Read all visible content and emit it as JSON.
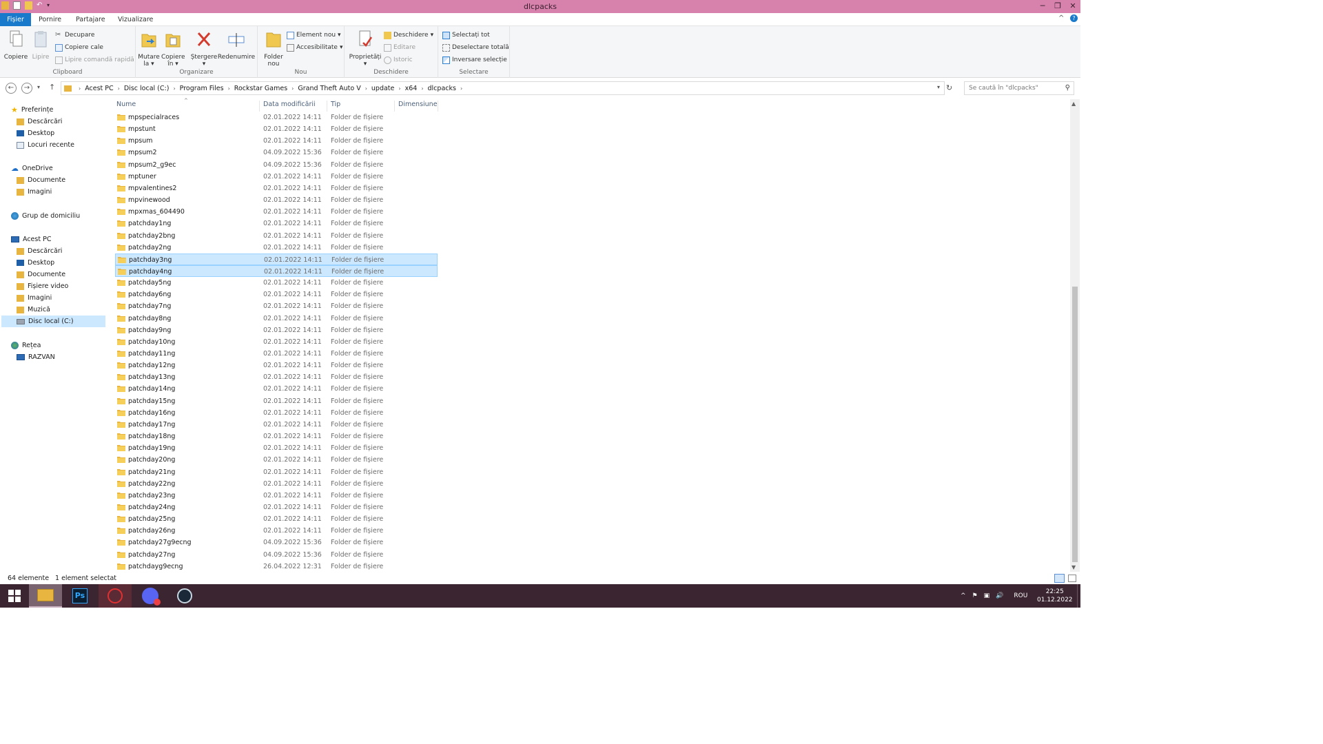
{
  "window": {
    "title": "dlcpacks",
    "minimize": "─",
    "maximize": "❐",
    "close": "✕"
  },
  "tabs": {
    "file": "Fișier",
    "home": "Pornire",
    "share": "Partajare",
    "view": "Vizualizare",
    "collapse": "^",
    "help": "?"
  },
  "ribbon": {
    "clipboard": {
      "label": "Clipboard",
      "copy": "Copiere",
      "paste": "Lipire",
      "cut": "Decupare",
      "copy_path": "Copiere cale",
      "paste_shortcut": "Lipire comandă rapidă"
    },
    "organize": {
      "label": "Organizare",
      "move_to": "Mutare",
      "move_to_2": "la",
      "copy_to": "Copiere",
      "copy_to_2": "în",
      "delete": "Ștergere",
      "rename": "Redenumire"
    },
    "new": {
      "label": "Nou",
      "new_folder": "Folder",
      "new_folder_2": "nou",
      "new_item": "Element nou",
      "easy_access": "Accesibilitate"
    },
    "open": {
      "label": "Deschidere",
      "properties": "Proprietăți",
      "open": "Deschidere",
      "edit": "Editare",
      "history": "Istoric"
    },
    "select": {
      "label": "Selectare",
      "select_all": "Selectați tot",
      "select_none": "Deselectare totală",
      "invert": "Inversare selecție"
    }
  },
  "address": {
    "crumbs": [
      "Acest PC",
      "Disc local (C:)",
      "Program Files",
      "Rockstar Games",
      "Grand Theft Auto V",
      "update",
      "x64",
      "dlcpacks"
    ],
    "search_placeholder": "Se caută în \"dlcpacks\""
  },
  "nav": {
    "favorites": "Preferințe",
    "fav_downloads": "Descărcări",
    "fav_desktop": "Desktop",
    "fav_recent": "Locuri recente",
    "onedrive": "OneDrive",
    "od_documents": "Documente",
    "od_images": "Imagini",
    "homegroup": "Grup de domiciliu",
    "thispc": "Acest PC",
    "pc_downloads": "Descărcări",
    "pc_desktop": "Desktop",
    "pc_documents": "Documente",
    "pc_videos": "Fișiere video",
    "pc_images": "Imagini",
    "pc_music": "Muzică",
    "pc_disk": "Disc local (C:)",
    "network": "Rețea",
    "net_razvan": "RAZVAN"
  },
  "columns": {
    "name": "Nume",
    "date": "Data modificării",
    "type": "Tip",
    "size": "Dimensiune"
  },
  "files": [
    {
      "name": "mpspecialraces",
      "date": "02.01.2022 14:11",
      "type": "Folder de fișiere"
    },
    {
      "name": "mpstunt",
      "date": "02.01.2022 14:11",
      "type": "Folder de fișiere"
    },
    {
      "name": "mpsum",
      "date": "02.01.2022 14:11",
      "type": "Folder de fișiere"
    },
    {
      "name": "mpsum2",
      "date": "04.09.2022 15:36",
      "type": "Folder de fișiere"
    },
    {
      "name": "mpsum2_g9ec",
      "date": "04.09.2022 15:36",
      "type": "Folder de fișiere"
    },
    {
      "name": "mptuner",
      "date": "02.01.2022 14:11",
      "type": "Folder de fișiere"
    },
    {
      "name": "mpvalentines2",
      "date": "02.01.2022 14:11",
      "type": "Folder de fișiere"
    },
    {
      "name": "mpvinewood",
      "date": "02.01.2022 14:11",
      "type": "Folder de fișiere"
    },
    {
      "name": "mpxmas_604490",
      "date": "02.01.2022 14:11",
      "type": "Folder de fișiere"
    },
    {
      "name": "patchday1ng",
      "date": "02.01.2022 14:11",
      "type": "Folder de fișiere"
    },
    {
      "name": "patchday2bng",
      "date": "02.01.2022 14:11",
      "type": "Folder de fișiere"
    },
    {
      "name": "patchday2ng",
      "date": "02.01.2022 14:11",
      "type": "Folder de fișiere"
    },
    {
      "name": "patchday3ng",
      "date": "02.01.2022 14:11",
      "type": "Folder de fișiere"
    },
    {
      "name": "patchday4ng",
      "date": "02.01.2022 14:11",
      "type": "Folder de fișiere"
    },
    {
      "name": "patchday5ng",
      "date": "02.01.2022 14:11",
      "type": "Folder de fișiere"
    },
    {
      "name": "patchday6ng",
      "date": "02.01.2022 14:11",
      "type": "Folder de fișiere"
    },
    {
      "name": "patchday7ng",
      "date": "02.01.2022 14:11",
      "type": "Folder de fișiere"
    },
    {
      "name": "patchday8ng",
      "date": "02.01.2022 14:11",
      "type": "Folder de fișiere"
    },
    {
      "name": "patchday9ng",
      "date": "02.01.2022 14:11",
      "type": "Folder de fișiere"
    },
    {
      "name": "patchday10ng",
      "date": "02.01.2022 14:11",
      "type": "Folder de fișiere"
    },
    {
      "name": "patchday11ng",
      "date": "02.01.2022 14:11",
      "type": "Folder de fișiere"
    },
    {
      "name": "patchday12ng",
      "date": "02.01.2022 14:11",
      "type": "Folder de fișiere"
    },
    {
      "name": "patchday13ng",
      "date": "02.01.2022 14:11",
      "type": "Folder de fișiere"
    },
    {
      "name": "patchday14ng",
      "date": "02.01.2022 14:11",
      "type": "Folder de fișiere"
    },
    {
      "name": "patchday15ng",
      "date": "02.01.2022 14:11",
      "type": "Folder de fișiere"
    },
    {
      "name": "patchday16ng",
      "date": "02.01.2022 14:11",
      "type": "Folder de fișiere"
    },
    {
      "name": "patchday17ng",
      "date": "02.01.2022 14:11",
      "type": "Folder de fișiere"
    },
    {
      "name": "patchday18ng",
      "date": "02.01.2022 14:11",
      "type": "Folder de fișiere"
    },
    {
      "name": "patchday19ng",
      "date": "02.01.2022 14:11",
      "type": "Folder de fișiere"
    },
    {
      "name": "patchday20ng",
      "date": "02.01.2022 14:11",
      "type": "Folder de fișiere"
    },
    {
      "name": "patchday21ng",
      "date": "02.01.2022 14:11",
      "type": "Folder de fișiere"
    },
    {
      "name": "patchday22ng",
      "date": "02.01.2022 14:11",
      "type": "Folder de fișiere"
    },
    {
      "name": "patchday23ng",
      "date": "02.01.2022 14:11",
      "type": "Folder de fișiere"
    },
    {
      "name": "patchday24ng",
      "date": "02.01.2022 14:11",
      "type": "Folder de fișiere"
    },
    {
      "name": "patchday25ng",
      "date": "02.01.2022 14:11",
      "type": "Folder de fișiere"
    },
    {
      "name": "patchday26ng",
      "date": "02.01.2022 14:11",
      "type": "Folder de fișiere"
    },
    {
      "name": "patchday27g9ecng",
      "date": "04.09.2022 15:36",
      "type": "Folder de fișiere"
    },
    {
      "name": "patchday27ng",
      "date": "04.09.2022 15:36",
      "type": "Folder de fișiere"
    },
    {
      "name": "patchdayg9ecng",
      "date": "26.04.2022 12:31",
      "type": "Folder de fișiere"
    }
  ],
  "selected_rows": [
    12,
    13
  ],
  "status": {
    "count": "64 elemente",
    "selected": "1 element selectat"
  },
  "taskbar": {
    "lang": "ROU",
    "time": "22:25",
    "date": "01.12.2022",
    "photoshop": "Ps"
  },
  "colors": {
    "titlebar": "#d682ad",
    "accent": "#1979ca",
    "selection": "#cce8ff",
    "taskbar": "#3a2530"
  }
}
